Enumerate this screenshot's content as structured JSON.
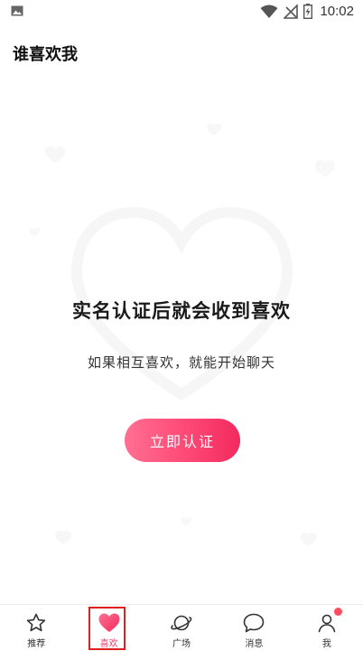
{
  "status_bar": {
    "time": "10:02"
  },
  "header": {
    "title": "谁喜欢我"
  },
  "empty_state": {
    "title": "实名认证后就会收到喜欢",
    "subtitle": "如果相互喜欢，就能开始聊天",
    "button_label": "立即认证"
  },
  "tabs": [
    {
      "label": "推荐",
      "icon": "star-icon"
    },
    {
      "label": "喜欢",
      "icon": "heart-icon",
      "active": true
    },
    {
      "label": "广场",
      "icon": "planet-icon"
    },
    {
      "label": "消息",
      "icon": "chat-bubble-icon"
    },
    {
      "label": "我",
      "icon": "person-icon",
      "badge": true
    }
  ],
  "colors": {
    "accent": "#f23a68",
    "button_start": "#ff6f91",
    "button_end": "#f22a5e"
  }
}
